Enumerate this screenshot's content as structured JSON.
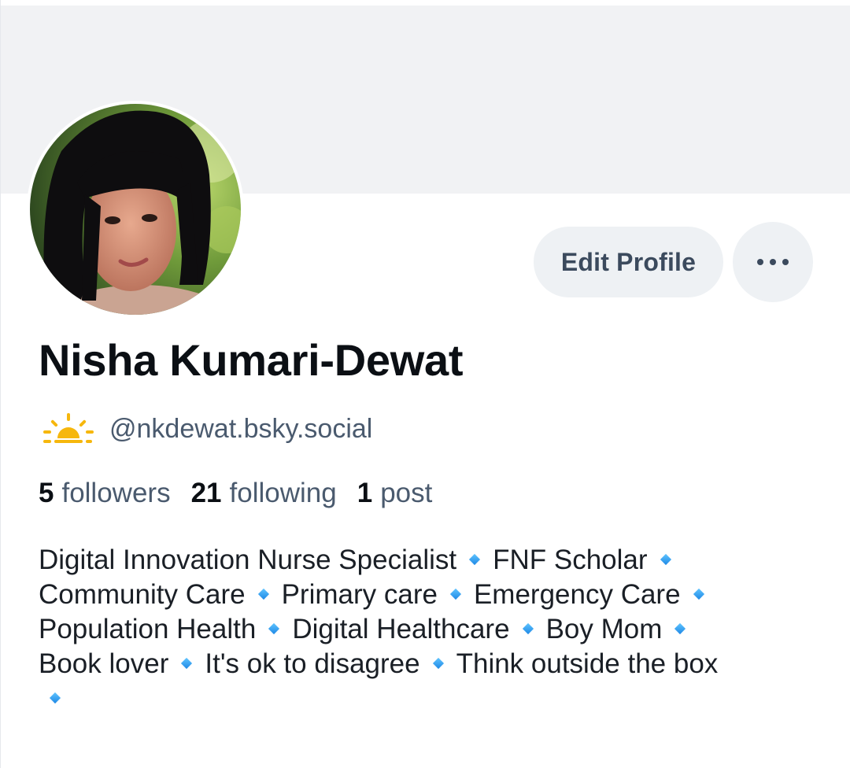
{
  "profile": {
    "display_name": "Nisha Kumari-Dewat",
    "handle": "@nkdewat.bsky.social",
    "handle_icon": "sun-behind-cloud-icon",
    "avatar_alt": "profile photo"
  },
  "actions": {
    "edit_profile_label": "Edit Profile",
    "more_icon": "more-horizontal-icon"
  },
  "stats": {
    "followers_count": "5",
    "followers_label": "followers",
    "following_count": "21",
    "following_label": "following",
    "posts_count": "1",
    "posts_label": "post"
  },
  "bio": {
    "separator_icon": "small-blue-diamond-icon",
    "lines": [
      [
        "Digital Innovation Nurse Specialist",
        "FNF Scholar"
      ],
      [
        "Community Care",
        "Primary care",
        "Emergency Care"
      ],
      [
        "Population Health",
        "Digital Healthcare",
        "Boy Mom"
      ],
      [
        "Book lover",
        "It's ok to disagree",
        "Think outside the box"
      ]
    ]
  },
  "colors": {
    "banner": "#f1f2f4",
    "button_bg": "#eef1f4",
    "button_text": "#3b4a5d",
    "secondary_text": "#4a5a6e",
    "diamond": "#1e88e5"
  }
}
